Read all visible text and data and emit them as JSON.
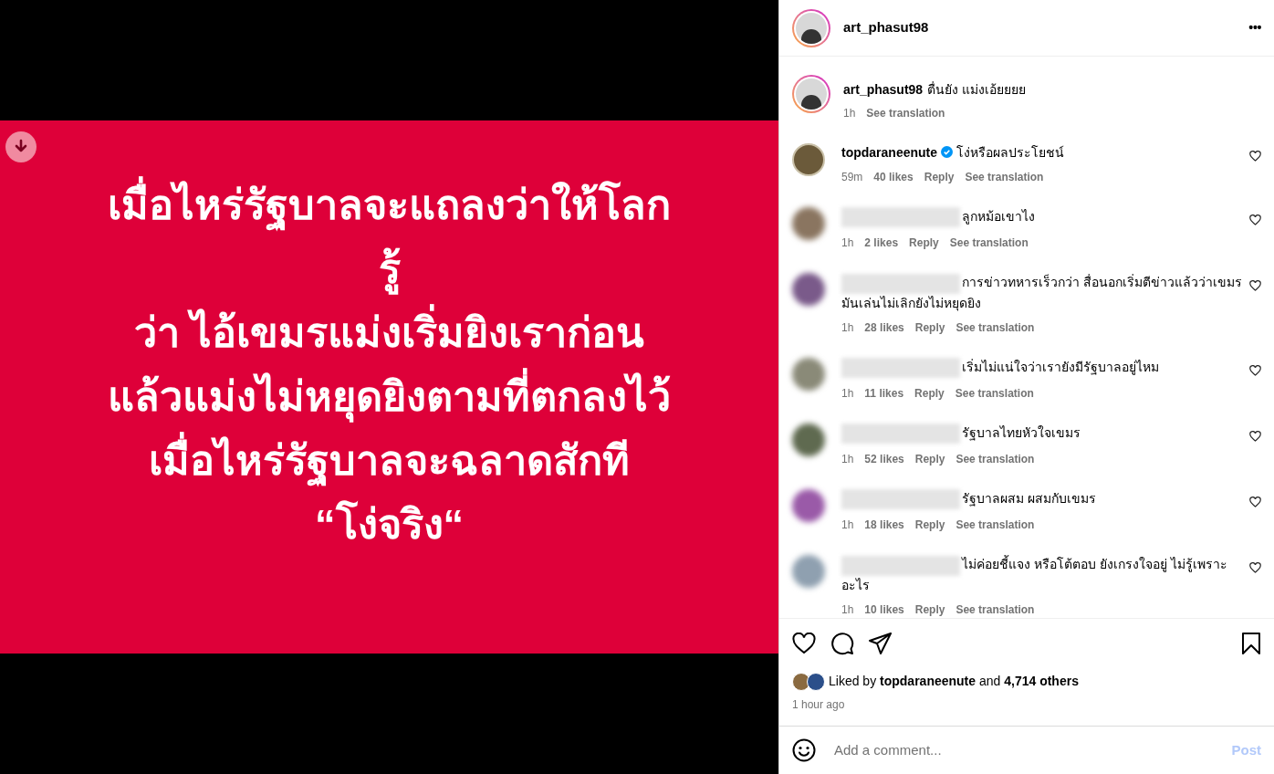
{
  "post_image": {
    "lines": [
      "เมื่อไหร่รัฐบาลจะแถลงว่าให้โลก",
      "รู้",
      "ว่า ไอ้เขมรแม่งเริ่มยิงเราก่อน",
      "แล้วแม่งไม่หยุดยิงตามที่ตกลงไว้",
      "เมื่อไหร่รัฐบาลจะฉลาดสักที",
      "“โง่จริง“"
    ]
  },
  "header": {
    "username": "art_phasut98",
    "more": "•••"
  },
  "caption": {
    "username": "art_phasut98",
    "text": "ตื่นยัง แม่งเอ้ยยยย",
    "time": "1h",
    "translate": "See translation"
  },
  "comments": [
    {
      "username": "topdaraneenute",
      "verified": true,
      "hidden": false,
      "color": "#6b5a3a",
      "text": "โง่หรือผลประโยชน์",
      "time": "59m",
      "likes": "40 likes",
      "reply": "Reply",
      "translate": "See translation"
    },
    {
      "hidden": true,
      "color": "#8a7560",
      "text": "ลูกหม้อเขาไง",
      "time": "1h",
      "likes": "2 likes",
      "reply": "Reply",
      "translate": "See translation"
    },
    {
      "hidden": true,
      "color": "#7a5a8a",
      "text": "การข่าวทหารเร็วกว่า สื่อนอกเริ่มตีข่าวแล้วว่าเขมรมันเล่นไม่เลิกยังไม่หยุดยิง",
      "time": "1h",
      "likes": "28 likes",
      "reply": "Reply",
      "translate": "See translation"
    },
    {
      "hidden": true,
      "color": "#8a8a78",
      "text": "เริ่มไม่แน่ใจว่าเรายังมีรัฐบาลอยู่ไหม",
      "time": "1h",
      "likes": "11 likes",
      "reply": "Reply",
      "translate": "See translation"
    },
    {
      "hidden": true,
      "color": "#5f6a50",
      "text": "รัฐบาลไทยหัวใจเขมร",
      "time": "1h",
      "likes": "52 likes",
      "reply": "Reply",
      "translate": "See translation"
    },
    {
      "hidden": true,
      "color": "#9a5aa8",
      "text": "รัฐบาลผสม ผสมกับเขมร",
      "time": "1h",
      "likes": "18 likes",
      "reply": "Reply",
      "translate": "See translation"
    },
    {
      "hidden": true,
      "color": "#8fa0b0",
      "text": "ไม่ค่อยชี้แจง หรือโต้ตอบ ยังเกรงใจอยู่ ไม่รู้เพราะอะไร",
      "time": "1h",
      "likes": "10 likes",
      "reply": "Reply",
      "translate": "See translation"
    }
  ],
  "likes": {
    "prefix": "Liked by",
    "user": "topdaraneenute",
    "middle": "and",
    "count": "4,714 others",
    "time": "1 hour ago"
  },
  "comment_box": {
    "placeholder": "Add a comment...",
    "post": "Post"
  }
}
